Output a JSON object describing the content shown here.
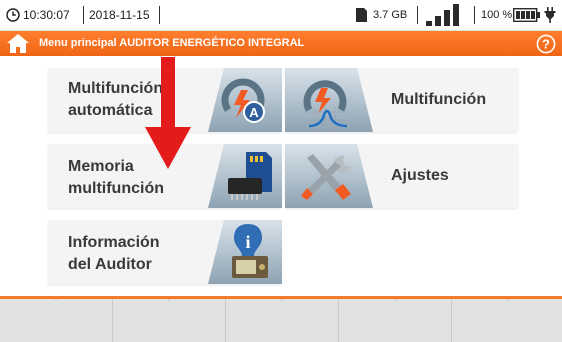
{
  "status_bar": {
    "time": "10:30:07",
    "date": "2018-11-15",
    "storage": "3.7 GB",
    "battery_percent": "100 %",
    "signal_level": 4,
    "signal_max": 4,
    "battery_level": 1.0,
    "icons": [
      "clock-icon",
      "sd-card-icon",
      "signal-bars-icon",
      "battery-icon",
      "power-plug-icon"
    ]
  },
  "title_bar": {
    "title": "Menu principal AUDITOR ENERGÉTICO INTEGRAL",
    "accent_color": "#f47b2c",
    "icons": [
      "home-icon",
      "help-icon"
    ]
  },
  "menu": {
    "tiles": [
      {
        "label_line1": "Multifunción",
        "label_line2": "automática",
        "icon": "auto-measurement-icon"
      },
      {
        "label_line1": "Multifunción",
        "label_line2": "",
        "icon": "multifunction-meter-icon"
      },
      {
        "label_line1": "Memoria",
        "label_line2": "multifunción",
        "icon": "memory-card-chip-icon"
      },
      {
        "label_line1": "Ajustes",
        "label_line2": "",
        "icon": "tools-icon"
      },
      {
        "label_line1": "Información",
        "label_line2": "del Auditor",
        "icon": "info-device-icon"
      }
    ]
  },
  "annotation": {
    "arrow_color": "#e31b1b",
    "icon": "red-arrow-down-icon"
  },
  "bottom_bar": {
    "softkeys": [
      "",
      "",
      "",
      "",
      ""
    ]
  }
}
